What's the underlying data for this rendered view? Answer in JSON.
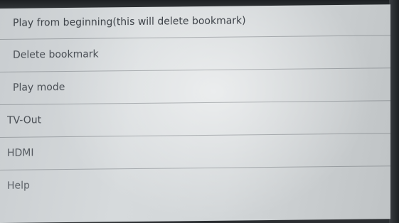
{
  "menu": {
    "items": [
      {
        "label": "Play from beginning(this will delete bookmark)"
      },
      {
        "label": "Delete bookmark"
      },
      {
        "label": "Play mode"
      },
      {
        "label": "TV-Out"
      },
      {
        "label": "HDMI"
      },
      {
        "label": "Help"
      }
    ]
  },
  "colors": {
    "menu_background": "#d2d6d8",
    "text": "#4a4f55",
    "divider": "#8a8f93",
    "bezel": "#2a2d30"
  }
}
